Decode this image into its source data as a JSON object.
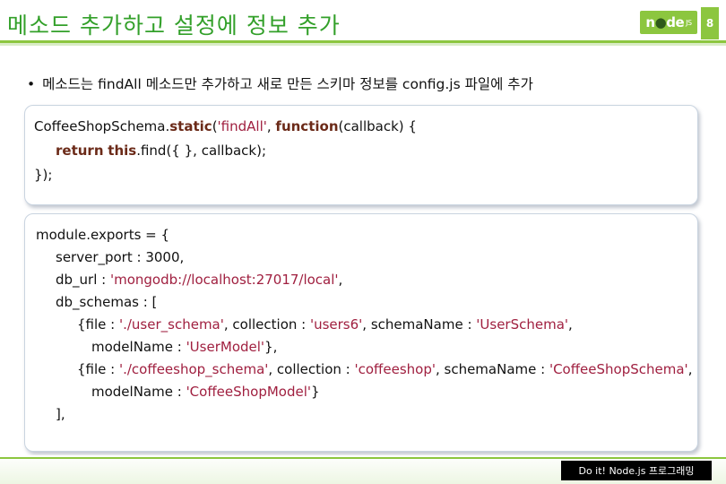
{
  "slide": {
    "title": "메소드 추가하고 설정에 정보 추가",
    "logo": {
      "part1": "n",
      "part2": "●",
      "part3": "de",
      "suffix": "JS"
    },
    "page_number": "8",
    "bullet": "메소드는 findAll 메소드만 추가하고 새로 만든 스키마 정보를 config.js 파일에 추가",
    "bullet_marker": "•",
    "footer": "Do it! Node.js 프로그래밍"
  },
  "code_block_1": {
    "line1": {
      "a": "CoffeeShopSchema.",
      "b": "static",
      "c": "(",
      "d": "'findAll'",
      "e": ", ",
      "f": "function",
      "g": "(callback) {"
    },
    "line2": {
      "a": "return",
      "b": " ",
      "c": "this",
      "d": ".find({ }, callback);"
    },
    "line3": "});"
  },
  "code_block_2": {
    "line1": "module.exports = {",
    "line2": "server_port : 3000,",
    "line3": {
      "a": "db_url : ",
      "b": "'mongodb://localhost:27017/local'",
      "c": ","
    },
    "line4": "db_schemas : [",
    "line5": {
      "a": "{file : ",
      "b": "'./user_schema'",
      "c": ", collection : ",
      "d": "'users6'",
      "e": ", schemaName : ",
      "f": "'UserSchema'",
      "g": ","
    },
    "line6": {
      "a": "modelName : ",
      "b": "'UserModel'",
      "c": "},"
    },
    "line7": {
      "a": "{file : ",
      "b": "'./coffeeshop_schema'",
      "c": ", collection : ",
      "d": "'coffeeshop'",
      "e": ", schemaName : ",
      "f": "'CoffeeShopSchema'",
      "g": ","
    },
    "line8": {
      "a": "modelName : ",
      "b": "'CoffeeShopModel'",
      "c": "}"
    },
    "line9": "],"
  },
  "colors": {
    "accent": "#8cc63f",
    "title": "#33a02a",
    "keyword": "#6b2a18",
    "string": "#a02040"
  }
}
